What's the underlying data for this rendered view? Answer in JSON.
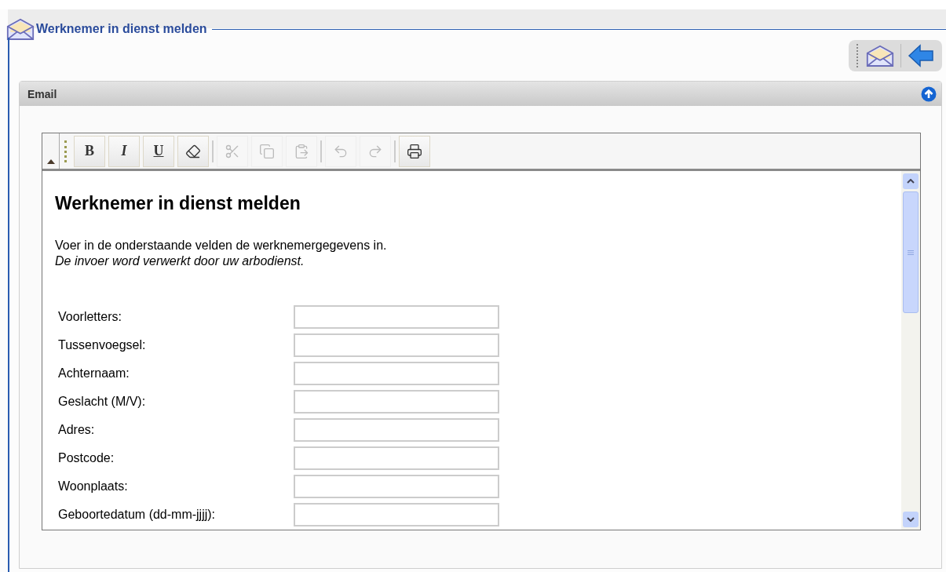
{
  "header": {
    "title": "Werknemer in dienst melden"
  },
  "panel": {
    "title": "Email"
  },
  "toolbar_groups": [
    [
      {
        "kind": "bold",
        "label": "B",
        "disabled": false
      },
      {
        "kind": "italic",
        "label": "I",
        "disabled": false
      },
      {
        "kind": "underline",
        "label": "U",
        "disabled": false
      },
      {
        "kind": "eraser",
        "disabled": false
      }
    ],
    [
      {
        "kind": "cut",
        "disabled": true
      },
      {
        "kind": "copy",
        "disabled": true
      },
      {
        "kind": "paste",
        "disabled": true
      }
    ],
    [
      {
        "kind": "undo",
        "disabled": true
      },
      {
        "kind": "redo",
        "disabled": true
      }
    ],
    [
      {
        "kind": "print",
        "disabled": false
      }
    ]
  ],
  "document": {
    "heading": "Werknemer in dienst melden",
    "intro": "Voer in de onderstaande velden de werknemergegevens in.",
    "note": "De invoer word verwerkt door uw arbodienst.",
    "fields": [
      {
        "label": "Voorletters:"
      },
      {
        "label": "Tussenvoegsel:"
      },
      {
        "label": "Achternaam:"
      },
      {
        "label": "Geslacht (M/V):"
      },
      {
        "label": "Adres:"
      },
      {
        "label": "Postcode:"
      },
      {
        "label": "Woonplaats:"
      },
      {
        "label": "Geboortedatum (dd-mm-jjjj):"
      }
    ]
  }
}
